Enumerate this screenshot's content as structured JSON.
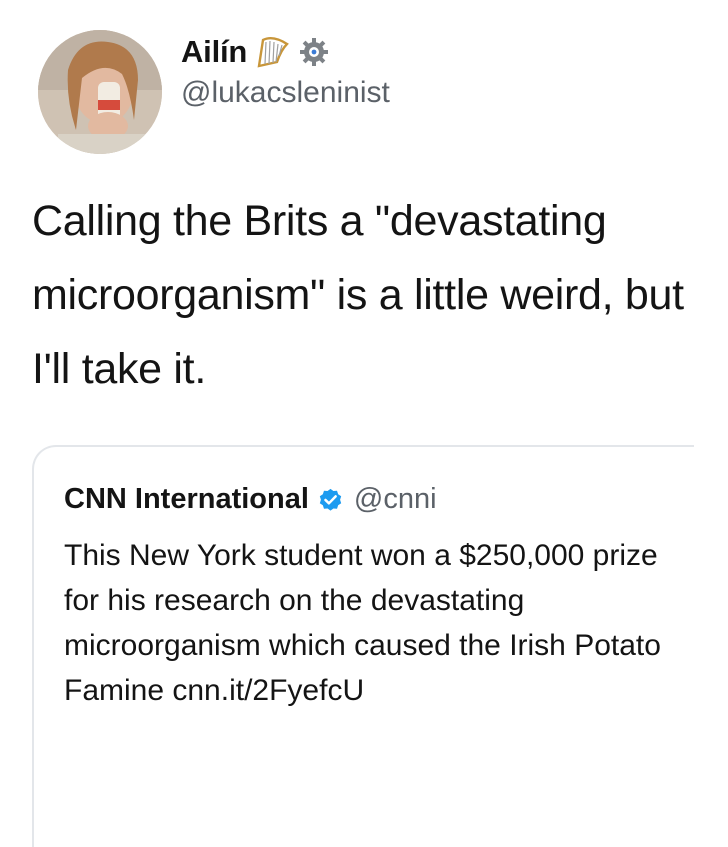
{
  "tweet": {
    "display_name": "Ailín",
    "name_emojis": [
      "harp-icon",
      "gear-icon"
    ],
    "handle": "@lukacsleninist",
    "text": "Calling the Brits a \"devastating microorganism\" is a little weird, but I'll take it."
  },
  "quoted_tweet": {
    "display_name": "CNN International",
    "verified": true,
    "handle": "@cnni",
    "text": "This New York student won a $250,000 prize for his research on the devastating microorganism which caused the Irish Potato Famine cnn.it/2FyefcU"
  },
  "colors": {
    "text": "#141414",
    "secondary_text": "#5b6168",
    "verified_blue": "#1d9bf0",
    "border": "#e3e6ea"
  }
}
